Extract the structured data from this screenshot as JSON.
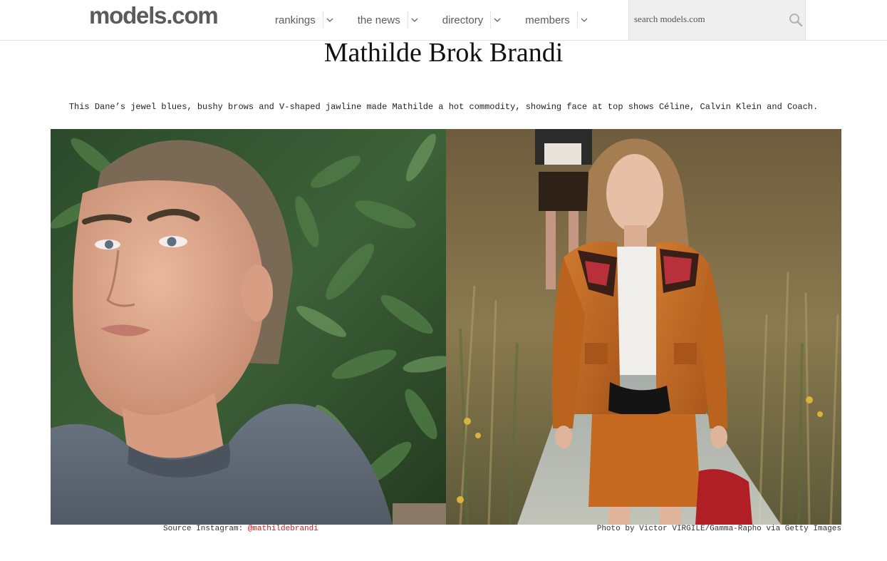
{
  "site": {
    "logo_main": "models",
    "logo_tld": ".com"
  },
  "nav": {
    "items": [
      {
        "label": "rankings"
      },
      {
        "label": "the news"
      },
      {
        "label": "directory"
      },
      {
        "label": "members"
      }
    ]
  },
  "search": {
    "placeholder": "search models.com",
    "icon": "magnifier"
  },
  "article": {
    "title": "Mathilde Brok Brandi",
    "description": "This Dane’s jewel blues, bushy brows and V-shaped jawline made Mathilde a hot commodity, showing face at top shows Céline, Calvin Klein and Coach.",
    "photos": [
      {
        "caption_prefix": "Source Instagram: ",
        "caption_link": "@mathildebrandi"
      },
      {
        "caption_text": "Photo by Victor VIRGILE/Gamma-Rapho via Getty Images"
      }
    ]
  },
  "colors": {
    "link": "#cc1a1a",
    "logo": "#5b5b5b",
    "search_bg": "#efefef",
    "jacket": "#c06a24",
    "sweater": "#5f6a77"
  }
}
